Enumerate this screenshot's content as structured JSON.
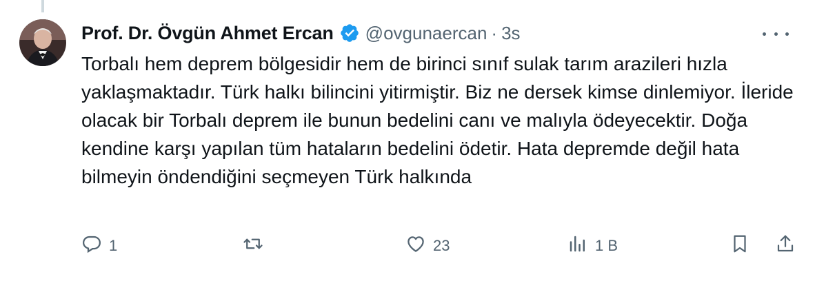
{
  "tweet": {
    "author_name": "Prof. Dr. Övgün Ahmet Ercan",
    "handle": "@ovgunaercan",
    "separator": "·",
    "time": "3s",
    "text": "Torbalı hem deprem bölgesidir hem de birinci sınıf sulak tarım arazileri hızla yaklaşmaktadır. Türk halkı bilincini yitirmiştir. Biz ne dersek kimse dinlemiyor. İleride olacak bir Torbalı deprem ile bunun bedelini canı ve malıyla ödeyecektir. Doğa kendine karşı yapılan tüm hataların bedelini ödetir. Hata depremde değil hata bilmeyin öndendiğini seçmeyen Türk halkında"
  },
  "actions": {
    "reply_count": "1",
    "retweet_count": "",
    "like_count": "23",
    "views_count": "1 B"
  },
  "colors": {
    "text": "#0f1419",
    "secondary": "#536471",
    "verified": "#1d9bf0",
    "thread_line": "#cfd9de"
  },
  "icons": [
    "verified-badge-icon",
    "more-icon",
    "reply-icon",
    "retweet-icon",
    "like-icon",
    "views-icon",
    "bookmark-icon",
    "share-icon"
  ]
}
